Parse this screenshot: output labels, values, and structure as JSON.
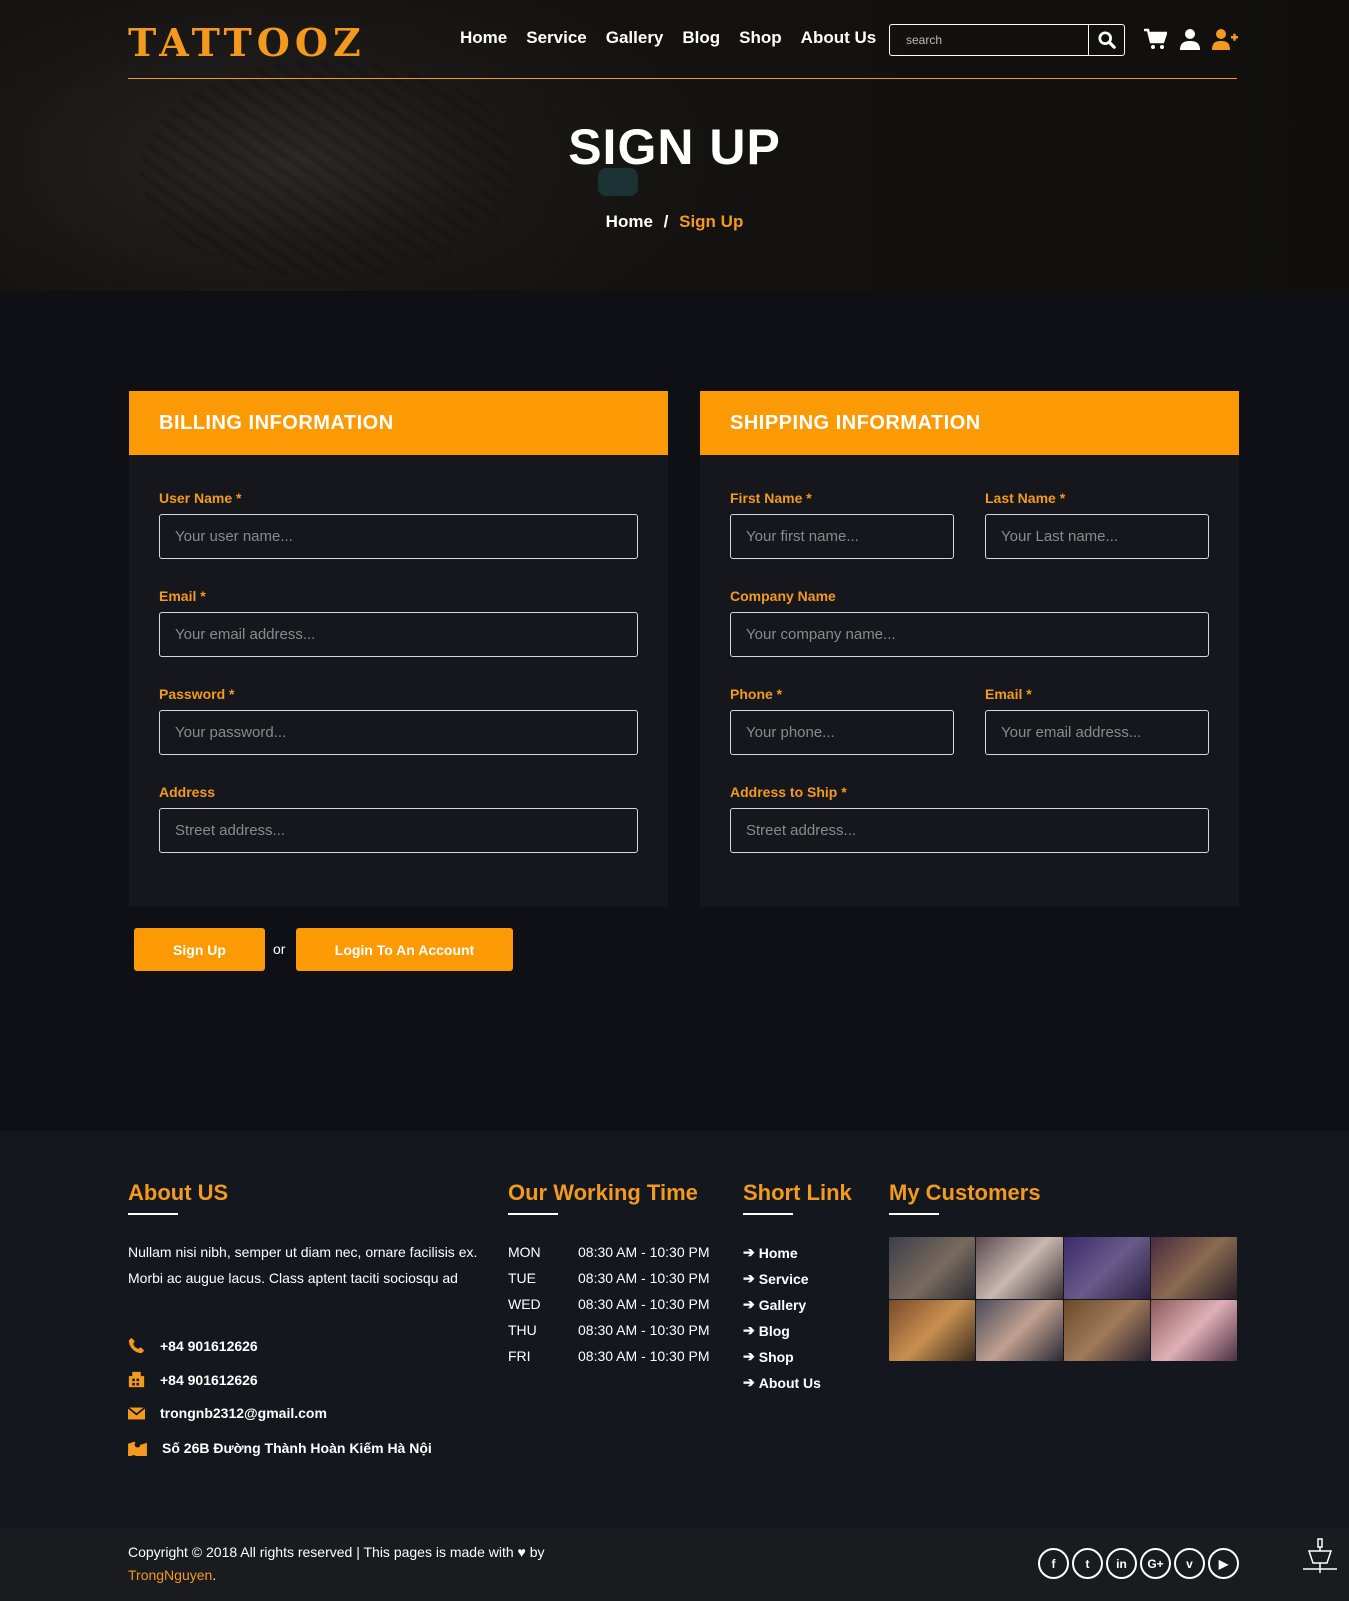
{
  "brand": {
    "logo": "TATTOOZ",
    "accent": "#fb9a05"
  },
  "nav": [
    "Home",
    "Service",
    "Gallery",
    "Blog",
    "Shop",
    "About Us"
  ],
  "search": {
    "placeholder": "search"
  },
  "hero": {
    "title": "SIGN UP",
    "crumb_home": "Home",
    "crumb_sep": "/",
    "crumb_current": "Sign Up"
  },
  "billing": {
    "title": "BILLING INFORMATION",
    "username_label": "User Name *",
    "username_ph": "Your user name...",
    "email_label": "Email *",
    "email_ph": "Your email address...",
    "password_label": "Password *",
    "password_ph": "Your password...",
    "address_label": "Address",
    "address_ph": "Street address..."
  },
  "shipping": {
    "title": "SHIPPING INFORMATION",
    "first_label": "First Name *",
    "first_ph": "Your first name...",
    "last_label": "Last Name *",
    "last_ph": "Your Last name...",
    "company_label": "Company Name",
    "company_ph": "Your company name...",
    "phone_label": "Phone *",
    "phone_ph": "Your phone...",
    "email_label": "Email *",
    "email_ph": "Your email address...",
    "ship_label": "Address to Ship *",
    "ship_ph": "Street address..."
  },
  "actions": {
    "signup": "Sign Up",
    "or": "or",
    "login": "Login To An Account"
  },
  "footer": {
    "about_title": "About US",
    "about_text": "Nullam nisi nibh, semper ut diam nec, ornare facilisis ex. Morbi ac augue lacus. Class aptent taciti sociosqu ad",
    "phone": "+84 901612626",
    "fax": "+84 901612626",
    "email": "trongnb2312@gmail.com",
    "address": "Số 26B Đường Thành Hoàn Kiếm Hà Nội",
    "working_title": "Our Working Time",
    "hours": [
      {
        "day": "MON",
        "time": "08:30 AM - 10:30 PM"
      },
      {
        "day": "TUE",
        "time": "08:30 AM - 10:30 PM"
      },
      {
        "day": "WED",
        "time": "08:30 AM - 10:30 PM"
      },
      {
        "day": "THU",
        "time": "08:30 AM - 10:30 PM"
      },
      {
        "day": "FRI",
        "time": "08:30 AM - 10:30 PM"
      }
    ],
    "links_title": "Short Link",
    "links": [
      "Home",
      "Service",
      "Gallery",
      "Blog",
      "Shop",
      "About Us"
    ],
    "customers_title": "My Customers"
  },
  "copyright": {
    "text": "Copyright © 2018 All rights reserved | This pages is made with",
    "by": "by",
    "author": "TrongNguyen",
    "end": "."
  },
  "social_icons": [
    "facebook-icon",
    "twitter-icon",
    "linkedin-icon",
    "google-plus-icon",
    "vimeo-icon",
    "youtube-icon"
  ]
}
